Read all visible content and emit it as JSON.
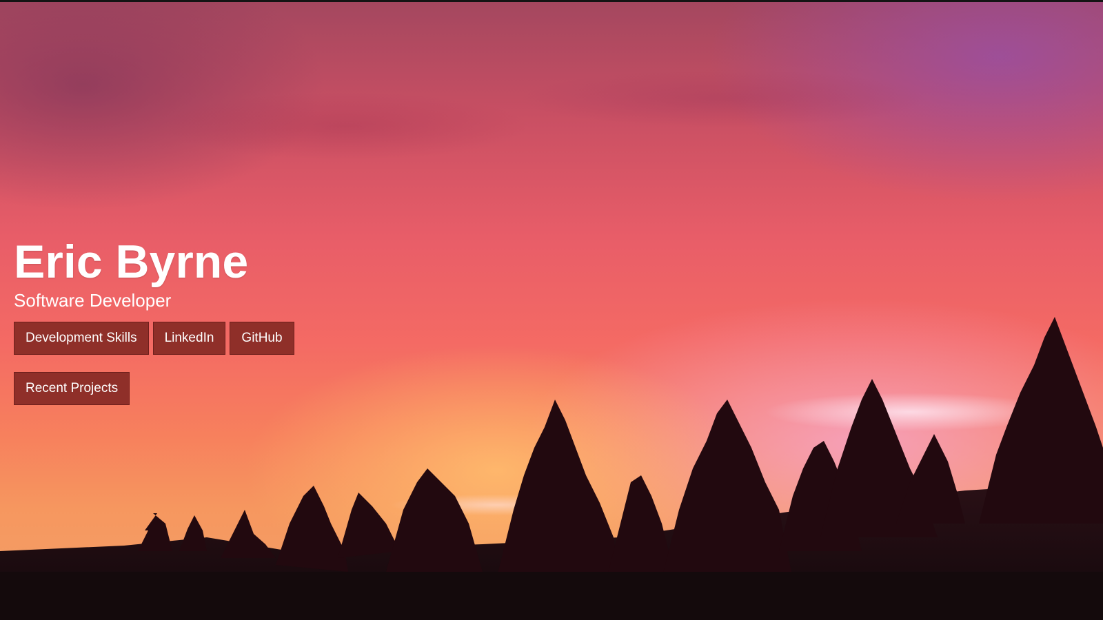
{
  "hero": {
    "name": "Eric Byrne",
    "title": "Software Developer",
    "buttons": [
      {
        "label": "Development Skills"
      },
      {
        "label": "LinkedIn"
      },
      {
        "label": "GitHub"
      }
    ],
    "secondary_buttons": [
      {
        "label": "Recent Projects"
      }
    ]
  },
  "colors": {
    "button_background": "#8f2f29",
    "button_border": "#6e1f1c",
    "text": "#ffffff"
  }
}
